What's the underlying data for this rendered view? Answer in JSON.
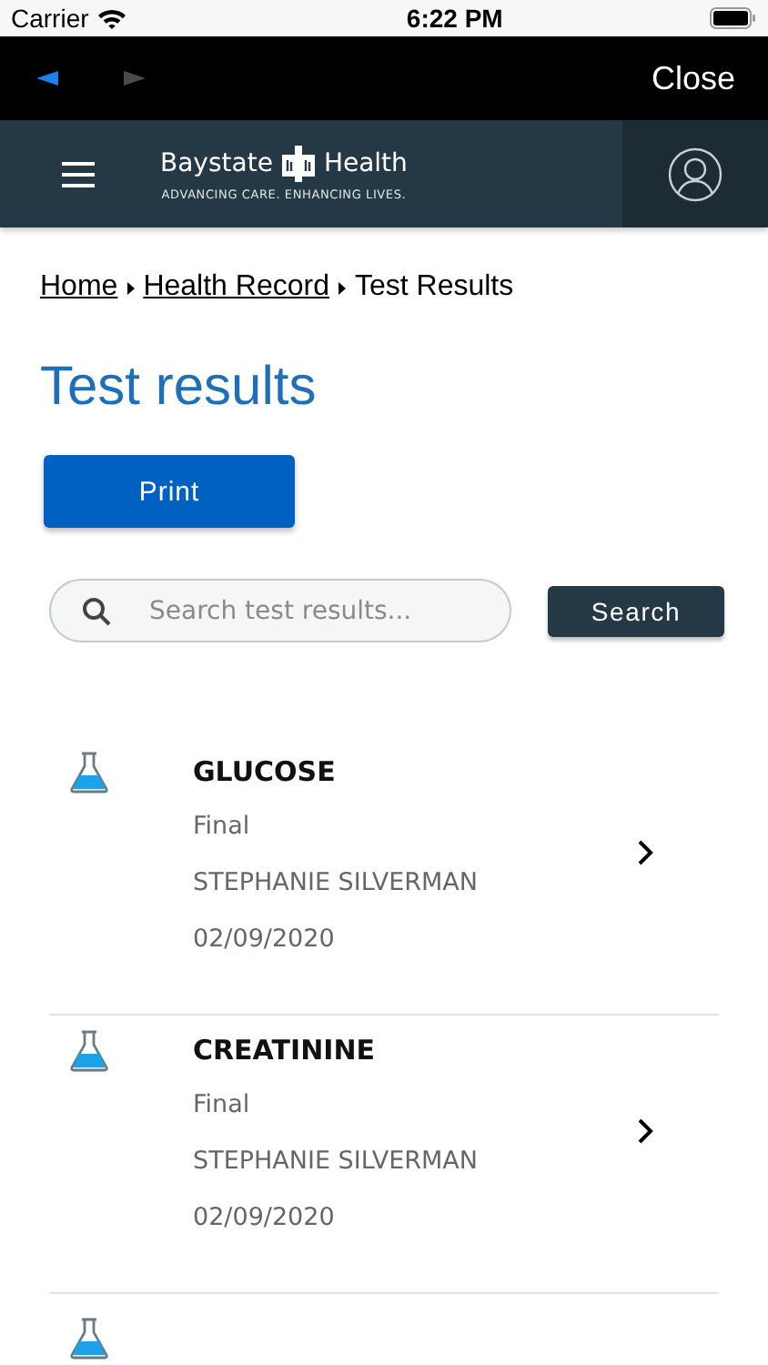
{
  "status_bar": {
    "carrier": "Carrier",
    "time": "6:22 PM"
  },
  "browser_bar": {
    "back_enabled": true,
    "forward_enabled": false,
    "close": "Close"
  },
  "header": {
    "brand_left": "Baystate",
    "brand_right": "Health",
    "tagline": "ADVANCING CARE. ENHANCING LIVES."
  },
  "breadcrumb": [
    {
      "label": "Home",
      "link": true
    },
    {
      "label": "Health Record",
      "link": true
    },
    {
      "label": "Test Results",
      "link": false
    }
  ],
  "title": "Test results",
  "print_button": "Print",
  "search": {
    "placeholder": "Search test results...",
    "button": "Search"
  },
  "results": [
    {
      "kind": "full",
      "name": "GLUCOSE",
      "status": "Final",
      "provider": "STEPHANIE SILVERMAN",
      "date": "02/09/2020"
    },
    {
      "kind": "full",
      "name": "CREATININE",
      "status": "Final",
      "provider": "STEPHANIE SILVERMAN",
      "date": "02/09/2020"
    },
    {
      "kind": "cut"
    }
  ]
}
